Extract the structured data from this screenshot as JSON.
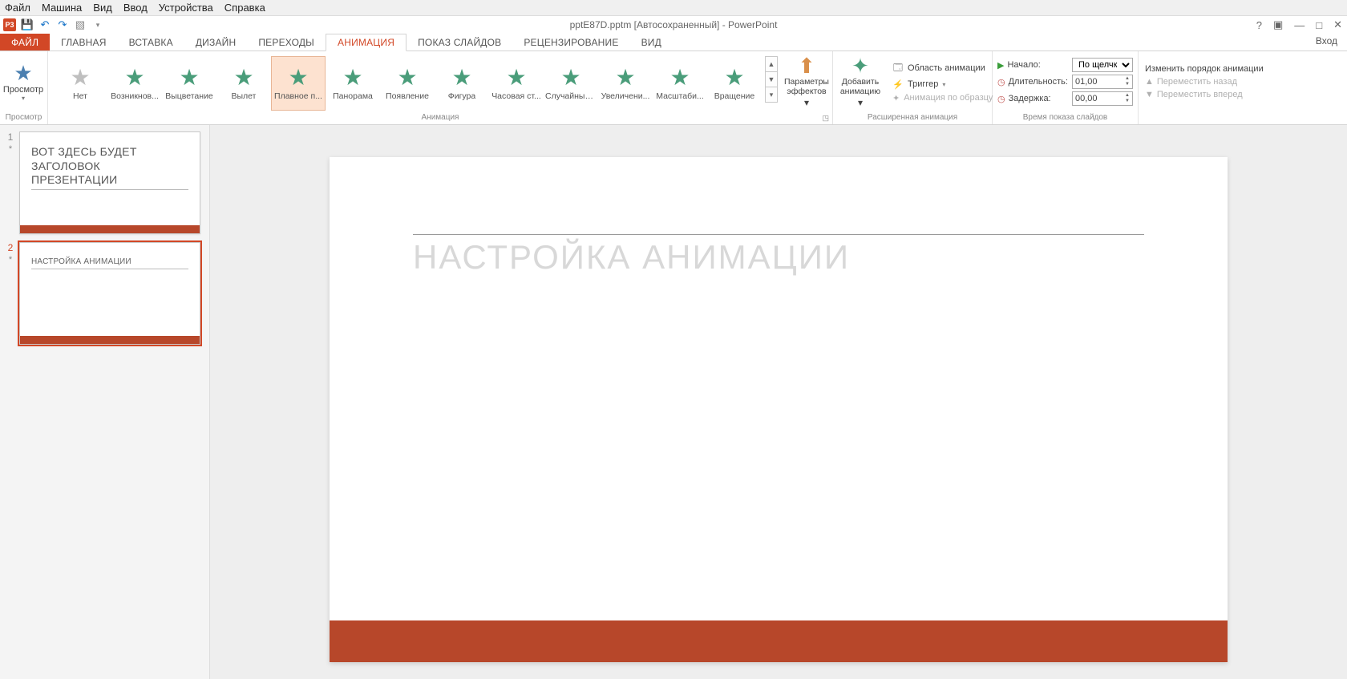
{
  "vb_menu": {
    "file": "Файл",
    "machine": "Машина",
    "view": "Вид",
    "input": "Ввод",
    "devices": "Устройства",
    "help": "Справка"
  },
  "qat": {
    "app": "P3"
  },
  "window_title": "pptE87D.pptm [Автосохраненный] - PowerPoint",
  "win": {
    "help": "?",
    "full": "▣",
    "min": "—",
    "close": "✕"
  },
  "tabs": {
    "file": "ФАЙЛ",
    "home": "ГЛАВНАЯ",
    "insert": "ВСТАВКА",
    "design": "ДИЗАЙН",
    "transitions": "ПЕРЕХОДЫ",
    "animations": "АНИМАЦИЯ",
    "slideshow": "ПОКАЗ СЛАЙДОВ",
    "review": "РЕЦЕНЗИРОВАНИЕ",
    "view": "ВИД"
  },
  "signin": "Вход",
  "groups": {
    "preview": {
      "label": "Просмотр",
      "btn": "Просмотр"
    },
    "animation": {
      "label": "Анимация",
      "items": [
        {
          "name": "Нет",
          "cls": "c-grey",
          "glyph": "★"
        },
        {
          "name": "Возникнов...",
          "cls": "c-green",
          "glyph": "✶"
        },
        {
          "name": "Выцветание",
          "cls": "c-green",
          "glyph": "★"
        },
        {
          "name": "Вылет",
          "cls": "c-green",
          "glyph": "★"
        },
        {
          "name": "Плавное п...",
          "cls": "c-green",
          "glyph": "★",
          "selected": true
        },
        {
          "name": "Панорама",
          "cls": "c-green",
          "glyph": "★"
        },
        {
          "name": "Появление",
          "cls": "c-green",
          "glyph": "★"
        },
        {
          "name": "Фигура",
          "cls": "c-green",
          "glyph": "★"
        },
        {
          "name": "Часовая ст...",
          "cls": "c-green",
          "glyph": "★"
        },
        {
          "name": "Случайные...",
          "cls": "c-green",
          "glyph": "✶"
        },
        {
          "name": "Увеличени...",
          "cls": "c-green",
          "glyph": "�источ"
        },
        {
          "name": "Масштаби...",
          "cls": "c-green",
          "glyph": "✶"
        },
        {
          "name": "Вращение",
          "cls": "c-green",
          "glyph": "★"
        }
      ],
      "effect_options": "Параметры\nэффектов"
    },
    "advanced": {
      "label": "Расширенная анимация",
      "add": "Добавить\nанимацию",
      "pane": "Область анимации",
      "trigger": "Триггер",
      "painter": "Анимация по образцу"
    },
    "timing": {
      "label": "Время показа слайдов",
      "start": "Начало:",
      "start_val": "По щелчку",
      "duration": "Длительность:",
      "duration_val": "01,00",
      "delay": "Задержка:",
      "delay_val": "00,00"
    },
    "reorder": {
      "header": "Изменить порядок анимации",
      "earlier": "Переместить назад",
      "later": "Переместить вперед"
    }
  },
  "thumbs": {
    "s1": {
      "num": "1",
      "ind": "*",
      "title_l1": "ВОТ ЗДЕСЬ БУДЕТ",
      "title_l2": "ЗАГОЛОВОК",
      "title_l3": "ПРЕЗЕНТАЦИИ"
    },
    "s2": {
      "num": "2",
      "ind": "*",
      "title": "НАСТРОЙКА АНИМАЦИИ"
    }
  },
  "slide": {
    "title": "НАСТРОЙКА АНИМАЦИИ"
  }
}
